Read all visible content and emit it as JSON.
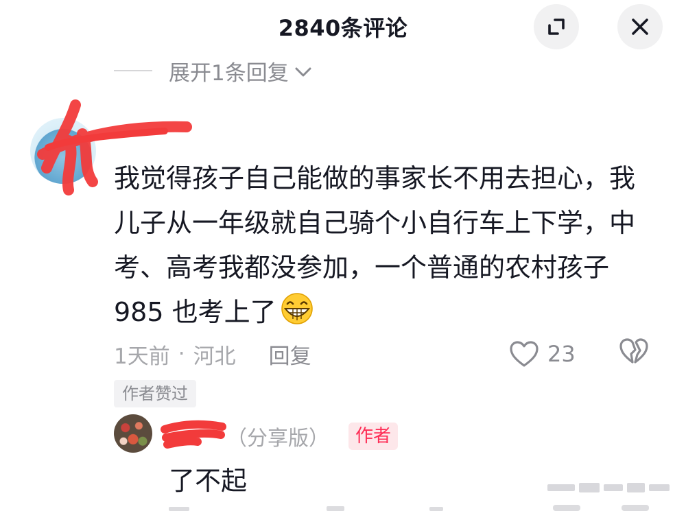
{
  "header": {
    "title": "2840条评论"
  },
  "thread": {
    "expand_label": "展开1条回复"
  },
  "comment": {
    "text": "我觉得孩子自己能做的事家长不用去担心，我儿子从一年级就自己骑个小自行车上下学，中考、高考我都没参加，一个普通的农村孩子 985 也考上了",
    "emoji": "grinning-face",
    "time": "1天前",
    "separator": "·",
    "location": "河北",
    "reply_label": "回复",
    "like_count": "23",
    "author_liked": "作者赞过"
  },
  "reply": {
    "name_suffix": "（分享版）",
    "author_badge": "作者",
    "text": "了不起"
  },
  "colors": {
    "accent": "#fe2c55",
    "redaction": "#f23b3b",
    "muted_text": "#8a8b91"
  }
}
